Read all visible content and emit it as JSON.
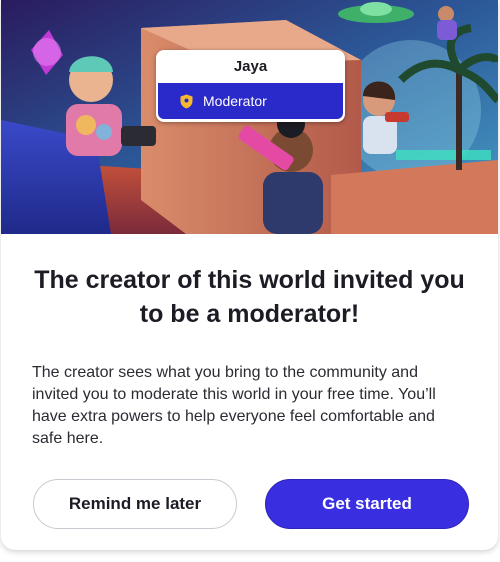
{
  "badge": {
    "name": "Jaya",
    "role": "Moderator"
  },
  "dialog": {
    "title": "The creator of this world invited you to be a moderator!",
    "body": "The creator sees what you bring to the community and invited you to moderate this world in your free time. You’ll have extra powers to help everyone feel comfortable and safe here."
  },
  "buttons": {
    "secondary_label": "Remind me later",
    "primary_label": "Get started"
  },
  "colors": {
    "primary": "#3a2fe0",
    "badge_role_bg": "#2a2acb",
    "shield_icon": "#f5b82e"
  },
  "icons": {
    "role": "shield-icon"
  }
}
